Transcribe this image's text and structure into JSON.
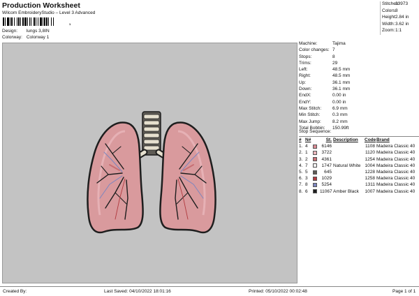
{
  "header": {
    "title": "Production Worksheet",
    "subtitle": "Wilcom EmbroideryStudio – Level 3 Advanced",
    "barcode_suffix": ",",
    "design_label": "Design:",
    "design_value": "lungs 3,8IN",
    "colorway_label": "Colorway:",
    "colorway_value": "Colorway 1"
  },
  "stats": [
    {
      "label": "Stitches:",
      "value": "33973"
    },
    {
      "label": "Colors:",
      "value": "8"
    },
    {
      "label": "Height:",
      "value": "2.84 in"
    },
    {
      "label": "Width:",
      "value": "3.62 in"
    },
    {
      "label": "Zoom:",
      "value": "1:1"
    }
  ],
  "machine": [
    {
      "label": "Machine:",
      "value": "Tajima"
    },
    {
      "label": "Color changes:",
      "value": "7"
    },
    {
      "label": "Stops:",
      "value": "8"
    },
    {
      "label": "Trims:",
      "value": "29"
    },
    {
      "label": "Left:",
      "value": "48.5 mm"
    },
    {
      "label": "Right:",
      "value": "48.5 mm"
    },
    {
      "label": "Up:",
      "value": "36.1 mm"
    },
    {
      "label": "Down:",
      "value": "36.1 mm"
    },
    {
      "label": "EndX:",
      "value": "0.00 in"
    },
    {
      "label": "EndY:",
      "value": "0.00 in"
    },
    {
      "label": "Max Stitch:",
      "value": "6.9 mm"
    },
    {
      "label": "Min Stitch:",
      "value": "0.3 mm"
    },
    {
      "label": "Max Jump:",
      "value": "8.2 mm"
    },
    {
      "label": "Total Bobbin:",
      "value": "150.99ft"
    }
  ],
  "sequence": {
    "title": "Stop Sequence:",
    "headers": {
      "idx": "#",
      "n": "N#",
      "st": "St.",
      "desc": "Description",
      "code": "Code",
      "brand": "Brand"
    },
    "rows": [
      {
        "idx": "1.",
        "n": "4",
        "color": "#d98a93",
        "st": "6146",
        "desc": "",
        "code": "1108",
        "brand": "Madeira Classic 40"
      },
      {
        "idx": "2.",
        "n": "1",
        "color": "#e9b6bc",
        "st": "3722",
        "desc": "",
        "code": "1120",
        "brand": "Madeira Classic 40"
      },
      {
        "idx": "3.",
        "n": "2",
        "color": "#c86f74",
        "st": "4361",
        "desc": "",
        "code": "1254",
        "brand": "Madeira Classic 40"
      },
      {
        "idx": "4.",
        "n": "7",
        "color": "#f1f1f1",
        "st": "1747",
        "desc": "Natural White",
        "code": "1004",
        "brand": "Madeira Classic 40"
      },
      {
        "idx": "5.",
        "n": "5",
        "color": "#5e5b55",
        "st": "645",
        "desc": "",
        "code": "1228",
        "brand": "Madeira Classic 40"
      },
      {
        "idx": "6.",
        "n": "3",
        "color": "#b13a3f",
        "st": "1029",
        "desc": "",
        "code": "1258",
        "brand": "Madeira Classic 40"
      },
      {
        "idx": "7.",
        "n": "8",
        "color": "#7d86bf",
        "st": "5254",
        "desc": "",
        "code": "1311",
        "brand": "Madeira Classic 40"
      },
      {
        "idx": "8.",
        "n": "6",
        "color": "#1e1e1e",
        "st": "11067",
        "desc": "Amber Black",
        "code": "1007",
        "brand": "Madeira Classic 40"
      }
    ]
  },
  "footer": {
    "created_by": "Created By:",
    "last_saved": "Last Saved: 04/10/2022 18:01:16",
    "printed": "Printed: 05/10/2022 00:02:48",
    "page": "Page 1 of 1"
  },
  "colors": {
    "canvas_bg": "#c3c3c3",
    "lung_fill": "#d99a9d",
    "lung_outline": "#1e1e1e",
    "trachea_fill": "#5e5b55",
    "vessel_blue": "#7d86bf",
    "vessel_red": "#b13a3f"
  }
}
